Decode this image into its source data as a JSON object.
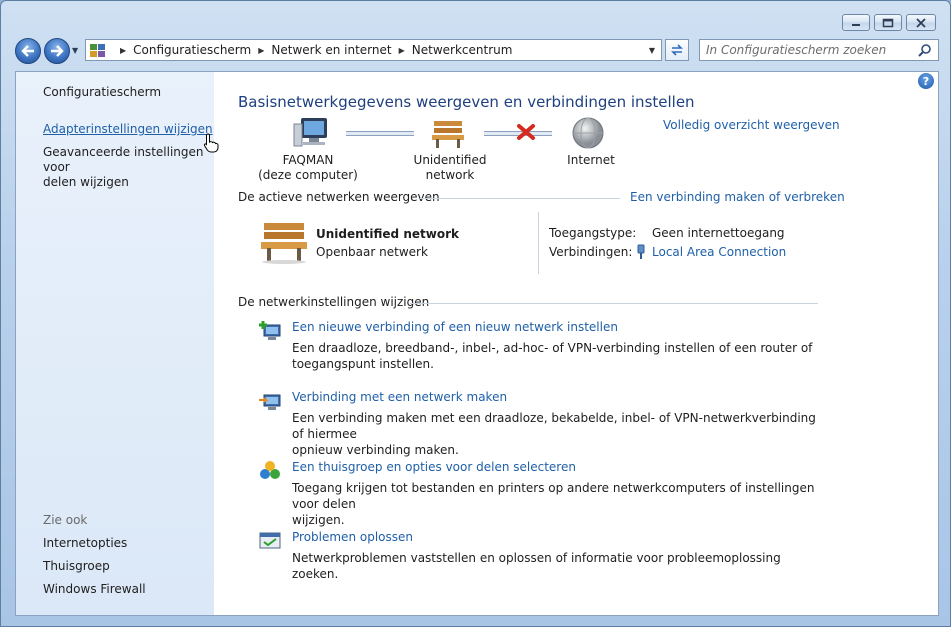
{
  "window": {
    "caption_buttons": [
      "minimize",
      "maximize",
      "close"
    ]
  },
  "navigation": {
    "back_icon": "back-arrow-icon",
    "forward_icon": "forward-arrow-icon"
  },
  "address_bar": {
    "crumbs": [
      "Configuratiescherm",
      "Netwerk en internet",
      "Netwerkcentrum"
    ]
  },
  "search": {
    "placeholder": "In Configuratiescherm zoeken"
  },
  "sidebar": {
    "home": "Configuratiescherm",
    "links": [
      "Adapterinstellingen wijzigen",
      "Geavanceerde instellingen voor",
      "delen wijzigen"
    ],
    "see_also_title": "Zie ook",
    "see_also": [
      "Internetopties",
      "Thuisgroep",
      "Windows Firewall"
    ]
  },
  "main": {
    "title": "Basisnetwerkgegevens weergeven en verbindingen instellen",
    "full_map_link": "Volledig overzicht weergeven",
    "map": {
      "computer_name": "FAQMAN",
      "computer_sub": "(deze computer)",
      "network": "Unidentified network",
      "internet": "Internet"
    },
    "active_networks": {
      "header": "De actieve netwerken weergeven",
      "connect_link": "Een verbinding maken of verbreken",
      "network_name": "Unidentified network",
      "network_type": "Openbaar netwerk",
      "access_label": "Toegangstype:",
      "access_value": "Geen internettoegang",
      "connections_label": "Verbindingen:",
      "connections_value": "Local Area Connection"
    },
    "change_settings": {
      "header": "De netwerkinstellingen wijzigen",
      "tasks": [
        {
          "title": "Een nieuwe verbinding of een nieuw netwerk instellen",
          "desc1": "Een draadloze, breedband-, inbel-, ad-hoc- of VPN-verbinding instellen of een router of",
          "desc2": "toegangspunt instellen."
        },
        {
          "title": "Verbinding met een netwerk maken",
          "desc1": "Een verbinding maken met een draadloze, bekabelde, inbel- of VPN-netwerkverbinding of hiermee",
          "desc2": "opnieuw verbinding maken."
        },
        {
          "title": "Een thuisgroep en opties voor delen selecteren",
          "desc1": "Toegang krijgen tot bestanden en printers op andere netwerkcomputers of instellingen voor delen",
          "desc2": "wijzigen."
        },
        {
          "title": "Problemen oplossen",
          "desc1": "Netwerkproblemen vaststellen en oplossen of informatie voor probleemoplossing zoeken.",
          "desc2": ""
        }
      ]
    }
  }
}
